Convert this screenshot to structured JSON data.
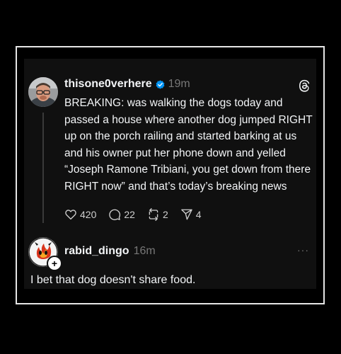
{
  "post": {
    "username": "thisone0verhere",
    "time": "19m",
    "text": "BREAKING: was walking the dogs today and passed a house where another dog jumped RIGHT up on the porch railing and started barking at us and his owner put her phone down and yelled “Joseph Ramone Tribiani, you get down from there RIGHT now” and that’s today’s breaking news",
    "likes": "420",
    "comments": "22",
    "reposts": "2",
    "shares": "4",
    "verified_color": "#0095f6",
    "icons": [
      "heart-icon",
      "comment-icon",
      "repost-icon",
      "share-icon",
      "threads-logo-icon",
      "verified-icon"
    ]
  },
  "reply": {
    "username": "rabid_dingo",
    "time": "16m",
    "text": "I bet that dog doesn't share food.",
    "more": "···",
    "plus": "+",
    "icons": [
      "more-icon",
      "follow-plus-icon"
    ]
  },
  "colors": {
    "background": "#000000",
    "card": "#101010",
    "text": "#f3f5f7",
    "muted": "#777777",
    "frame_border": "#e6e6e6"
  }
}
